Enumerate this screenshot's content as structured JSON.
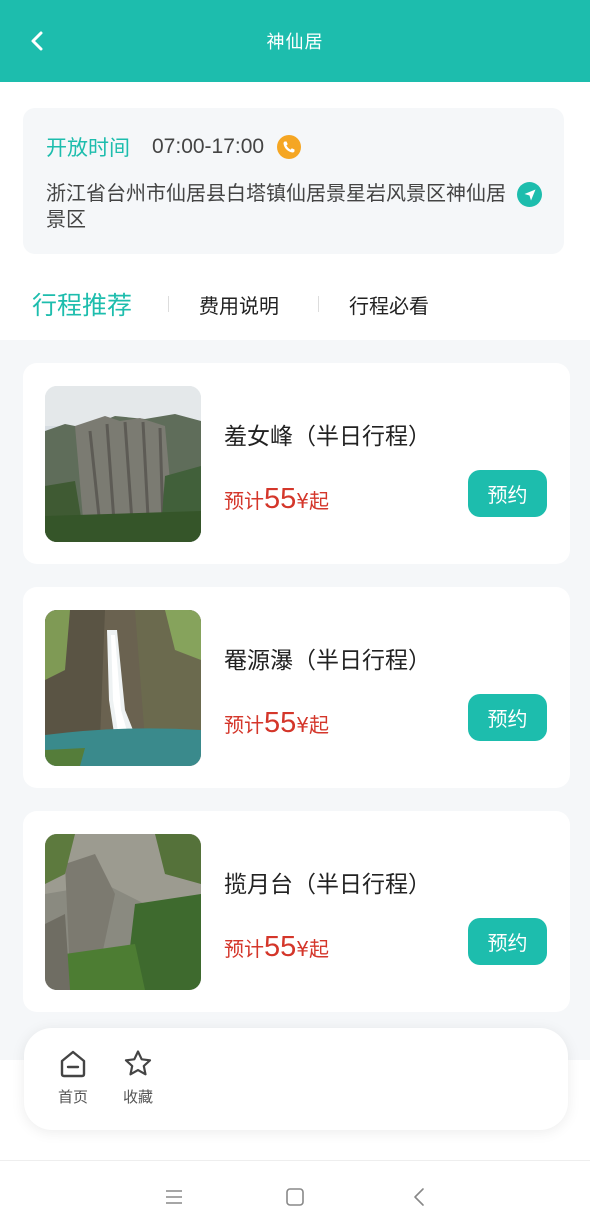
{
  "header": {
    "title": "神仙居"
  },
  "info": {
    "open_label": "开放时间",
    "open_time": "07:00-17:00",
    "address": "浙江省台州市仙居县白塔镇仙居景星岩风景区神仙居景区"
  },
  "tabs": [
    {
      "label": "行程推荐",
      "active": true
    },
    {
      "label": "费用说明",
      "active": false
    },
    {
      "label": "行程必看",
      "active": false
    }
  ],
  "items": [
    {
      "name": "羞女峰（半日行程）",
      "price_prefix": "预计",
      "price": "55",
      "price_suffix": "¥起",
      "button": "预约"
    },
    {
      "name": "罨源瀑（半日行程）",
      "price_prefix": "预计",
      "price": "55",
      "price_suffix": "¥起",
      "button": "预约"
    },
    {
      "name": "揽月台（半日行程）",
      "price_prefix": "预计",
      "price": "55",
      "price_suffix": "¥起",
      "button": "预约"
    }
  ],
  "bottom_nav": [
    {
      "label": "首页",
      "icon": "home-icon"
    },
    {
      "label": "收藏",
      "icon": "star-icon"
    }
  ],
  "colors": {
    "accent": "#1dbdad",
    "price": "#d4362a",
    "phone": "#f5a623"
  }
}
